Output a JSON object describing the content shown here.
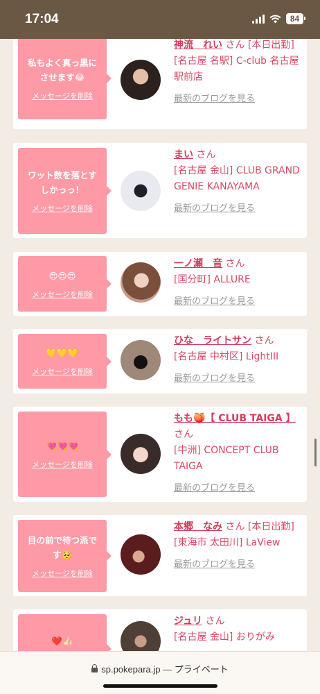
{
  "status": {
    "time": "17:04",
    "battery": "84"
  },
  "browser": {
    "url": "sp.pokepara.jp",
    "mode": "— プライベート"
  },
  "common": {
    "delete_label": "メッセージを削除",
    "blog_label": "最新のブログを見る",
    "suffix": "さん"
  },
  "cards": [
    {
      "message": "私もよく真っ黒に\nさせます😂",
      "name": "神流　れい",
      "badge": "[本日出勤]",
      "shop": "[名古屋 名駅] C-club 名古屋駅前店"
    },
    {
      "message": "ワット数を落とす\nしかっっ！",
      "name": "まい",
      "badge": "",
      "shop": "[名古屋 金山] CLUB GRAND GENIE KANAYAMA"
    },
    {
      "message": "😍😍😍",
      "name": "一ノ瀬　音",
      "badge": "",
      "shop": "[国分町] ALLURE"
    },
    {
      "message": "💛💛💛",
      "name": "ひな　ライトサン",
      "badge": "",
      "shop": "[名古屋 中村区] LightIII"
    },
    {
      "message": "💘💘💘",
      "name": "もも🍑【 CLUB TAIGA 】",
      "badge": "",
      "shop": "[中洲] CONCEPT CLUB TAIGA"
    },
    {
      "message": "目の前で待つ派で\nす🥺",
      "name": "本郷　なみ",
      "badge": "[本日出勤]",
      "shop": "[東海市 太田川] LaView"
    },
    {
      "message": "❤️👍🏻",
      "name": "ジュリ",
      "badge": "",
      "shop": "[名古屋 金山] おりがみ"
    }
  ]
}
